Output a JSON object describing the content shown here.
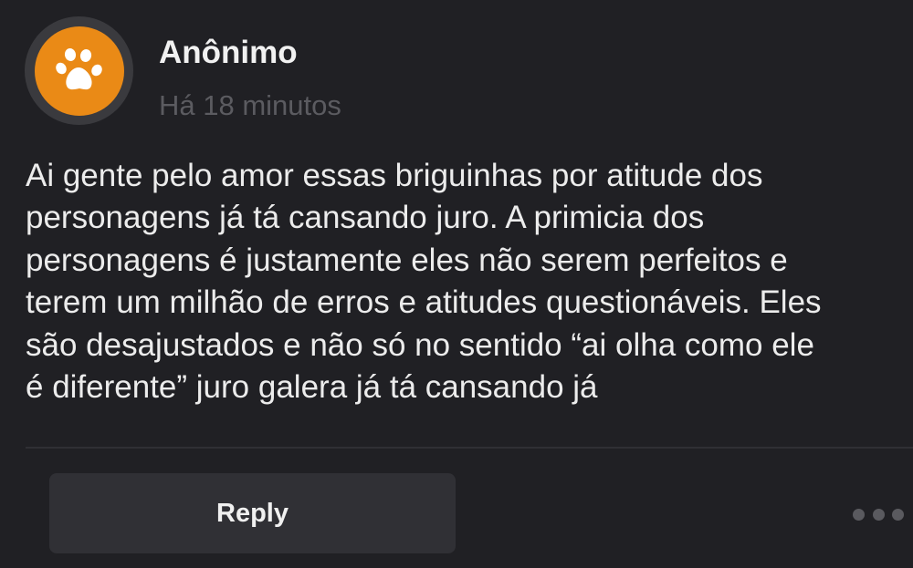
{
  "comment": {
    "author": "Anônimo",
    "timestamp": "Há 18 minutos",
    "avatar_icon": "paw-icon",
    "avatar_color": "#ea8a16",
    "text": "Ai gente pelo amor essas briguinhas por atitude dos\npersonagens já tá cansando juro. A primicia dos\npersonagens é justamente eles não serem perfeitos e\nterem um milhão de erros e atitudes questionáveis. Eles\nsão desajustados e não só no sentido “ai olha como ele\né diferente” juro galera já tá cansando já"
  },
  "actions": {
    "reply_label": "Reply",
    "more_icon": "more-horizontal-icon"
  }
}
